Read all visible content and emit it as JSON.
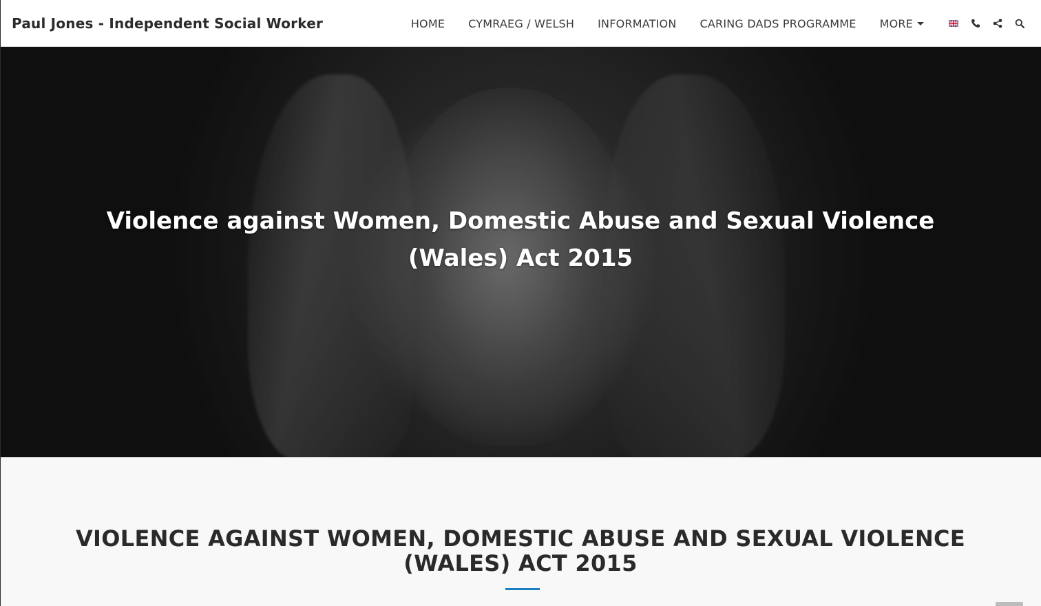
{
  "header": {
    "site_title": "Paul Jones - Independent Social Worker",
    "nav": [
      {
        "label": "HOME"
      },
      {
        "label": "CYMRAEG / WELSH"
      },
      {
        "label": "INFORMATION"
      },
      {
        "label": "CARING DADS PROGRAMME"
      },
      {
        "label": "MORE"
      }
    ],
    "icons": [
      "uk-flag-icon",
      "phone-icon",
      "share-icon",
      "search-icon"
    ]
  },
  "hero": {
    "title_line1": "Violence against Women, Domestic Abuse and Sexual Violence",
    "title_line2": "(Wales) Act 2015"
  },
  "content": {
    "heading_line1": "VIOLENCE AGAINST WOMEN, DOMESTIC ABUSE AND SEXUAL VIOLENCE",
    "heading_line2": "(WALES) ACT 2015"
  },
  "colors": {
    "accent": "#1a7fc1",
    "header_bg": "#ffffff",
    "content_bg": "#f8f8f8"
  }
}
